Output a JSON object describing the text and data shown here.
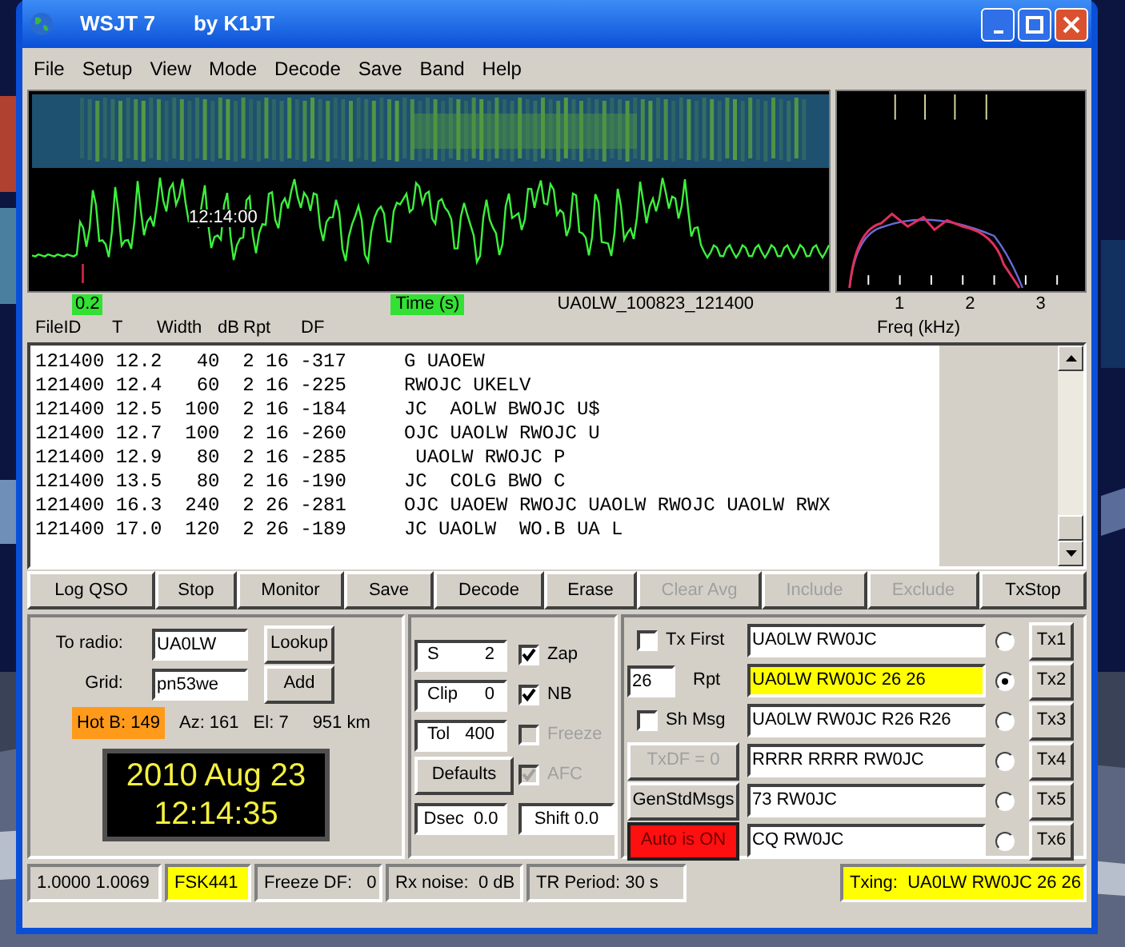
{
  "window": {
    "title": "WSJT 7",
    "subtitle": "by K1JT"
  },
  "menu": [
    "File",
    "Setup",
    "View",
    "Mode",
    "Decode",
    "Save",
    "Band",
    "Help"
  ],
  "plot": {
    "time_mark": "12:14:00",
    "scale_label": "0.2",
    "time_axis_label": "Time (s)",
    "file_name": "UA0LW_100823_121400",
    "freq_ticks": [
      "1",
      "2",
      "3"
    ],
    "freq_axis_label": "Freq (kHz)"
  },
  "decode_columns": [
    "FileID",
    "T",
    "Width",
    "dB",
    "Rpt",
    "DF"
  ],
  "decode_lines": [
    "121400 12.2   40  2 16 -317     G UAOEW",
    "121400 12.4   60  2 16 -225     RWOJC UKELV",
    "121400 12.5  100  2 16 -184     JC  AOLW BWOJC U$",
    "121400 12.7  100  2 16 -260     OJC UAOLW RWOJC U",
    "121400 12.9   80  2 16 -285      UAOLW RWOJC P",
    "121400 13.5   80  2 16 -190     JC  COLG BWO C",
    "121400 16.3  240  2 26 -281     OJC UAOEW RWOJC UAOLW RWOJC UAOLW RWX",
    "121400 17.0  120  2 26 -189     JC UAOLW  WO.B UA L"
  ],
  "buttons": [
    {
      "label": "Log QSO",
      "disabled": false
    },
    {
      "label": "Stop",
      "disabled": false
    },
    {
      "label": "Monitor",
      "disabled": false
    },
    {
      "label": "Save",
      "disabled": false
    },
    {
      "label": "Decode",
      "disabled": false
    },
    {
      "label": "Erase",
      "disabled": false
    },
    {
      "label": "Clear Avg",
      "disabled": true
    },
    {
      "label": "Include",
      "disabled": true
    },
    {
      "label": "Exclude",
      "disabled": true
    },
    {
      "label": "TxStop",
      "disabled": false
    }
  ],
  "station": {
    "to_radio_label": "To radio:",
    "to_radio": "UA0LW",
    "lookup": "Lookup",
    "grid_label": "Grid:",
    "grid": "pn53we",
    "add": "Add",
    "hot_b": "Hot B: 149",
    "az": "Az: 161",
    "el": "El: 7",
    "distance": "951 km",
    "date": "2010 Aug 23",
    "time": "12:14:35"
  },
  "settings": {
    "fields": [
      {
        "label": "S",
        "value": "2"
      },
      {
        "label": "Clip",
        "value": "0"
      },
      {
        "label": "Tol",
        "value": "400"
      }
    ],
    "defaults": "Defaults",
    "dsec": "Dsec  0.0",
    "shift": "Shift 0.0",
    "options": [
      {
        "label": "Zap",
        "checked": true,
        "disabled": false
      },
      {
        "label": "NB",
        "checked": true,
        "disabled": false
      },
      {
        "label": "Freeze",
        "checked": false,
        "disabled": true
      },
      {
        "label": "AFC",
        "checked": true,
        "disabled": true
      }
    ]
  },
  "tx": {
    "tx_first": {
      "label": "Tx First",
      "checked": false
    },
    "rpt_value": "26",
    "rpt_label": "Rpt",
    "sh_msg": {
      "label": "Sh Msg",
      "checked": false
    },
    "txdf": {
      "label": "TxDF = 0",
      "disabled": true
    },
    "gen": "GenStdMsgs",
    "auto": {
      "label": "Auto is ON",
      "on": true
    },
    "messages": [
      {
        "text": "UA0LW RW0JC",
        "selected": false,
        "button": "Tx1"
      },
      {
        "text": "UA0LW RW0JC 26 26",
        "selected": true,
        "button": "Tx2"
      },
      {
        "text": "UA0LW RW0JC R26 R26",
        "selected": false,
        "button": "Tx3"
      },
      {
        "text": "RRRR RRRR RW0JC",
        "selected": false,
        "button": "Tx4"
      },
      {
        "text": "73 RW0JC",
        "selected": false,
        "button": "Tx5"
      },
      {
        "text": "CQ RW0JC",
        "selected": false,
        "button": "Tx6"
      }
    ]
  },
  "status_bar": [
    {
      "text": "1.0000 1.0069",
      "highlight": false
    },
    {
      "text": "FSK441",
      "highlight": true
    },
    {
      "text": "Freeze DF:   0",
      "highlight": false
    },
    {
      "text": "Rx noise:  0 dB",
      "highlight": false
    },
    {
      "text": "TR Period: 30 s",
      "highlight": false
    },
    {
      "text": "Txing:  UA0LW RW0JC 26 26",
      "highlight": true
    }
  ]
}
